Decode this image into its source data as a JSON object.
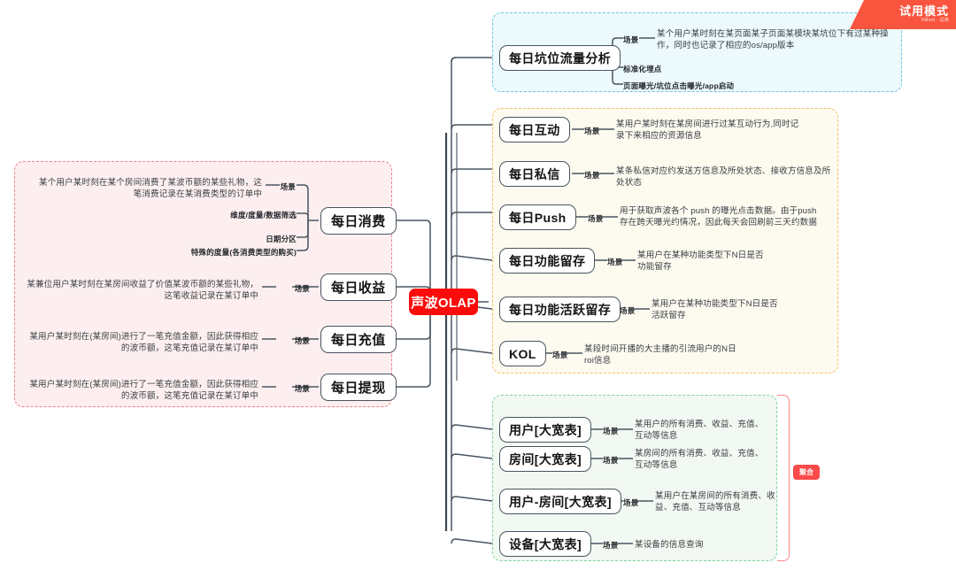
{
  "ribbon": {
    "title": "试用模式",
    "subtitle": "XMind · 试用"
  },
  "center": {
    "label": "声波OLAP",
    "color": "#fb0b0b"
  },
  "groups": {
    "blue": {
      "color": "#ecf9fd",
      "border": "#6fc3e0"
    },
    "orange": {
      "color": "#fdfaf0",
      "border": "#f4c162"
    },
    "green": {
      "color": "#f2f8f2",
      "border": "#7fd6a2"
    },
    "pink": {
      "color": "#fdeff0",
      "border": "#f0808c"
    }
  },
  "badge": {
    "label": "聚合",
    "color": "#fb4a4a"
  },
  "left_branches": [
    {
      "label": "每日消费",
      "subs": [
        {
          "label": "场景",
          "desc": "某个用户某时刻在某个房间消费了某波币额的某些礼物，这笔消费记录在某消费类型的订单中"
        },
        {
          "label": "维度/度量/数据筛选",
          "desc": ""
        },
        {
          "label": "日期分区",
          "desc": ""
        },
        {
          "label": "特殊的度量(各消费类型的购买)",
          "desc": ""
        }
      ]
    },
    {
      "label": "每日收益",
      "subs": [
        {
          "label": "场景",
          "desc": "某兼位用户某时刻在某房间收益了价值某波币额的某些礼物，这笔收益记录在某订单中"
        }
      ]
    },
    {
      "label": "每日充值",
      "subs": [
        {
          "label": "场景",
          "desc": "某用户某时刻在(某房间)进行了一笔充值金额，因此获得相应的波币额，这笔充值记录在某订单中"
        }
      ]
    },
    {
      "label": "每日提现",
      "subs": [
        {
          "label": "场景",
          "desc": "某用户某时刻在(某房间)进行了一笔充值金额，因此获得相应的波币额，这笔充值记录在某订单中"
        }
      ]
    }
  ],
  "right_branches": [
    {
      "group": "blue",
      "label": "每日坑位流量分析",
      "subs": [
        {
          "label": "场景",
          "desc": "某个用户某时刻在某页面某子页面某模块某坑位下有过某种操作，同时也记录了相应的os/app版本"
        },
        {
          "label": "标准化埋点",
          "desc": ""
        },
        {
          "label": "页面曝光/坑位点击曝光/app启动",
          "desc": ""
        }
      ]
    },
    {
      "group": "orange",
      "label": "每日互动",
      "subs": [
        {
          "label": "场景",
          "desc": "某用户某时刻在某房间进行过某互动行为,同时记录下来相应的资源信息"
        }
      ]
    },
    {
      "group": "orange",
      "label": "每日私信",
      "subs": [
        {
          "label": "场景",
          "desc": "某条私信对应约发送方信息及所处状态、接收方信息及所处状态"
        }
      ]
    },
    {
      "group": "orange",
      "label": "每日Push",
      "subs": [
        {
          "label": "场景",
          "desc": "用于获取声波各个 push 的曝光点击数据。由于push 存在跨天曝光约情况，因此每天会回刷前三天约数据"
        }
      ]
    },
    {
      "group": "orange",
      "label": "每日功能留存",
      "subs": [
        {
          "label": "场景",
          "desc": "某用户在某种功能类型下N日是否功能留存"
        }
      ]
    },
    {
      "group": "orange",
      "label": "每日功能活跃留存",
      "subs": [
        {
          "label": "场景",
          "desc": "某用户在某种功能类型下N日是否活跃留存"
        }
      ]
    },
    {
      "group": "orange",
      "label": "KOL",
      "subs": [
        {
          "label": "场景",
          "desc": "某段时间开播的大主播的引流用户的N日roi信息"
        }
      ]
    },
    {
      "group": "green",
      "label": "用户[大宽表]",
      "subs": [
        {
          "label": "场景",
          "desc": "某用户的所有消费、收益、充值、互动等信息"
        }
      ]
    },
    {
      "group": "green",
      "label": "房间[大宽表]",
      "subs": [
        {
          "label": "场景",
          "desc": "某房间的所有消费、收益、充值、互动等信息"
        }
      ]
    },
    {
      "group": "green",
      "label": "用户-房间[大宽表]",
      "subs": [
        {
          "label": "场景",
          "desc": "某用户在某房间的所有消费、收益、充值、互动等信息"
        }
      ]
    },
    {
      "group": "green",
      "label": "设备[大宽表]",
      "subs": [
        {
          "label": "场景",
          "desc": "某设备的信息查询"
        }
      ]
    }
  ]
}
